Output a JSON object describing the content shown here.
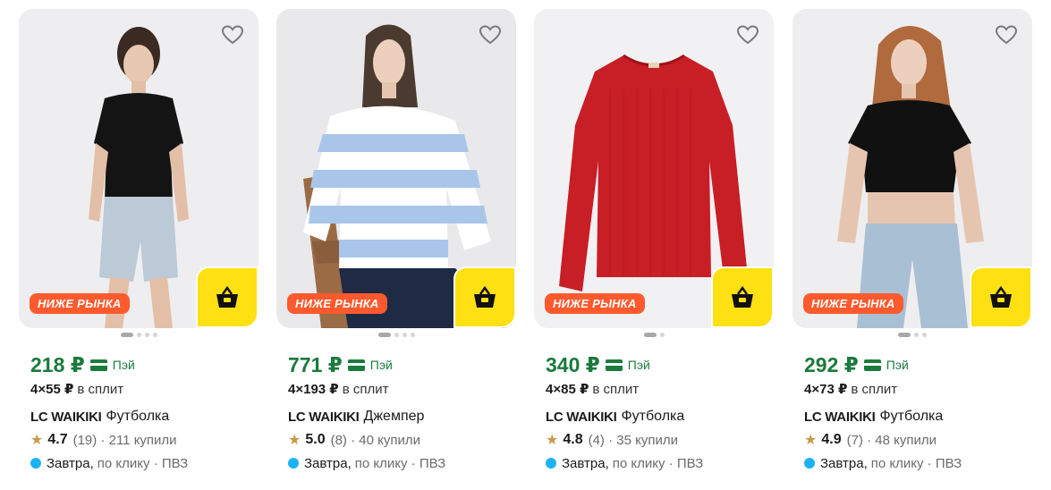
{
  "products": [
    {
      "badge": "НИЖЕ РЫНКА",
      "price": "218 ₽",
      "pay_label": "Пэй",
      "split_amount": "4×55 ₽",
      "split_label": "в сплит",
      "brand": "LC WAIKIKI",
      "name": "Футболка",
      "rating": "4.7",
      "reviews": "(19)",
      "bought": "· 211 купили",
      "delivery_day": "Завтра,",
      "delivery_rest": "по клику · ПВЗ",
      "photo_icon": "model-black-tshirt"
    },
    {
      "badge": "НИЖЕ РЫНКА",
      "price": "771 ₽",
      "pay_label": "Пэй",
      "split_amount": "4×193 ₽",
      "split_label": "в сплит",
      "brand": "LC WAIKIKI",
      "name": "Джемпер",
      "rating": "5.0",
      "reviews": "(8)",
      "bought": "· 40 купили",
      "delivery_day": "Завтра,",
      "delivery_rest": "по клику · ПВЗ",
      "photo_icon": "model-striped-sweater"
    },
    {
      "badge": "НИЖЕ РЫНКА",
      "price": "340 ₽",
      "pay_label": "Пэй",
      "split_amount": "4×85 ₽",
      "split_label": "в сплит",
      "brand": "LC WAIKIKI",
      "name": "Футболка",
      "rating": "4.8",
      "reviews": "(4)",
      "bought": "· 35 купили",
      "delivery_day": "Завтра,",
      "delivery_rest": "по клику · ПВЗ",
      "photo_icon": "red-longsleeve"
    },
    {
      "badge": "НИЖЕ РЫНКА",
      "price": "292 ₽",
      "pay_label": "Пэй",
      "split_amount": "4×73 ₽",
      "split_label": "в сплит",
      "brand": "LC WAIKIKI",
      "name": "Футболка",
      "rating": "4.9",
      "reviews": "(7)",
      "bought": "· 48 купили",
      "delivery_day": "Завтра,",
      "delivery_rest": "по клику · ПВЗ",
      "photo_icon": "model-black-croptop"
    }
  ],
  "colors": {
    "price_green": "#1c7a3d",
    "badge_orange": "#ff5a2e",
    "cart_yellow": "#ffe013",
    "delivery_dot": "#1cb3f5",
    "star": "#c79a4a"
  }
}
